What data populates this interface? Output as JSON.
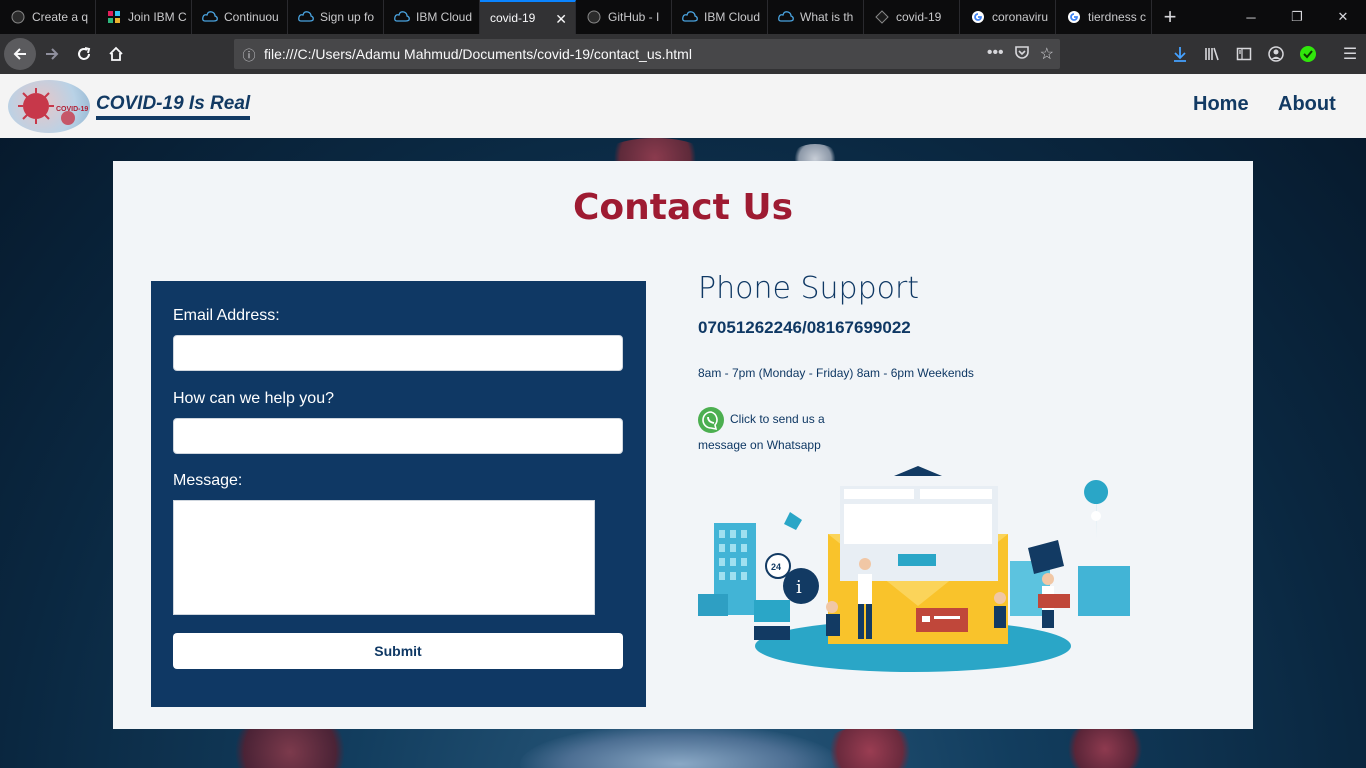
{
  "browser": {
    "tabs": [
      {
        "label": "Create a q",
        "icon": "github-icon"
      },
      {
        "label": "Join IBM C",
        "icon": "slack-icon"
      },
      {
        "label": "Continuou",
        "icon": "ibm-cloud-icon"
      },
      {
        "label": "Sign up fo",
        "icon": "ibm-cloud-icon"
      },
      {
        "label": "IBM Cloud",
        "icon": "ibm-cloud-icon"
      },
      {
        "label": "covid-19",
        "icon": "none",
        "active": true
      },
      {
        "label": "GitHub - I",
        "icon": "github-icon"
      },
      {
        "label": "IBM Cloud",
        "icon": "ibm-cloud-icon"
      },
      {
        "label": "What is th",
        "icon": "ibm-cloud-icon"
      },
      {
        "label": "covid-19",
        "icon": "github-icon"
      },
      {
        "label": "coronaviru",
        "icon": "google-icon"
      },
      {
        "label": "tierdness c",
        "icon": "google-icon"
      }
    ],
    "url": "file:///C:/Users/Adamu Mahmud/Documents/covid-19/contact_us.html"
  },
  "site": {
    "logo_text": "COVID-19 Is Real",
    "nav": {
      "home": "Home",
      "about": "About"
    }
  },
  "contact": {
    "title": "Contact Us",
    "form": {
      "email_label": "Email Address:",
      "email_value": "",
      "help_label": "How can we help you?",
      "help_value": "",
      "message_label": "Message:",
      "message_value": "",
      "submit_label": "Submit"
    },
    "support": {
      "title": "Phone Support",
      "phone": "07051262246/08167699022",
      "hours": "8am - 7pm (Monday - Friday) 8am - 6pm Weekends",
      "whatsapp_text": "Click to send us a message on Whatsapp"
    }
  },
  "colors": {
    "brand_navy": "#0f3864",
    "title_red": "#9e1b32",
    "whatsapp_green": "#4caf50",
    "chrome_dark": "#0c0c0d",
    "accent_blue": "#0a84ff"
  }
}
